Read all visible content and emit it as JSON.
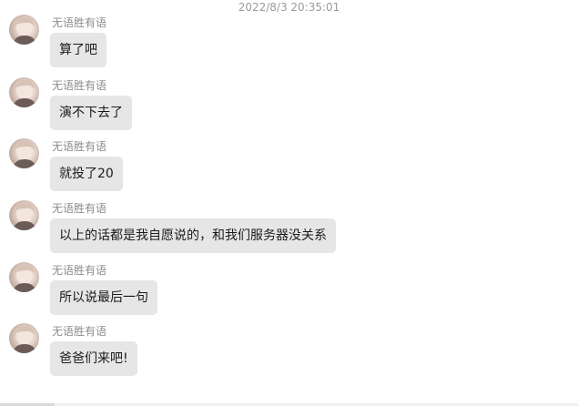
{
  "chat": {
    "timestamp": "2022/8/3 20:35:01",
    "messages": [
      {
        "sender": "无语胜有语",
        "text": "算了吧"
      },
      {
        "sender": "无语胜有语",
        "text": "演不下去了"
      },
      {
        "sender": "无语胜有语",
        "text": "就投了20"
      },
      {
        "sender": "无语胜有语",
        "text": "以上的话都是我自愿说的，和我们服务器没关系"
      },
      {
        "sender": "无语胜有语",
        "text": "所以说最后一句"
      },
      {
        "sender": "无语胜有语",
        "text": "爸爸们来吧!"
      }
    ]
  },
  "colors": {
    "bubble_bg": "#e6e6e6",
    "sender_text": "#8c8c8c",
    "timestamp_text": "#9a9a9a",
    "message_text": "#1a1a1a"
  },
  "icons": {
    "avatar": "avatar-icon"
  }
}
